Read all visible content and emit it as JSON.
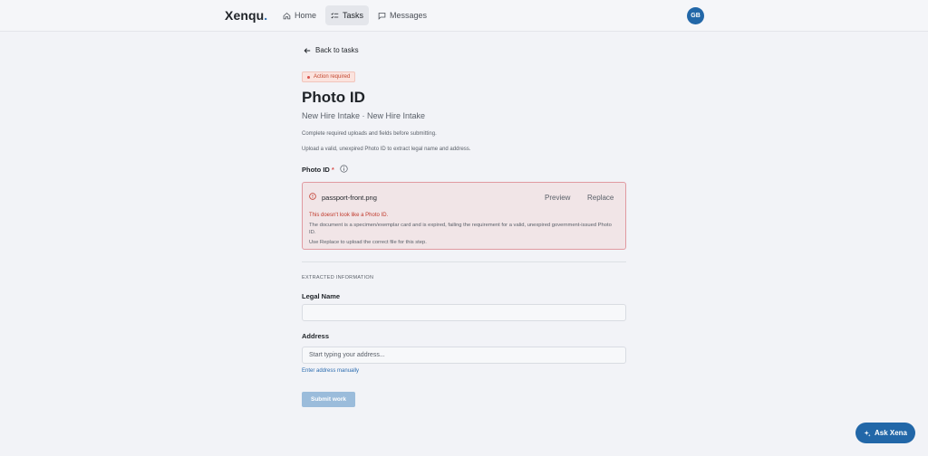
{
  "brand": {
    "name": "Xenqu",
    "suffix": "."
  },
  "nav": {
    "items": [
      {
        "label": "Home",
        "icon": "home-icon"
      },
      {
        "label": "Tasks",
        "icon": "tasks-icon",
        "active": true
      },
      {
        "label": "Messages",
        "icon": "messages-icon"
      }
    ]
  },
  "user": {
    "initials": "GB"
  },
  "back_link": "Back to tasks",
  "status_badge": "Action required",
  "page": {
    "title": "Photo ID",
    "subtitle": "New Hire Intake · New Hire Intake",
    "description_1": "Complete required uploads and fields before submitting.",
    "description_2": "Upload a valid, unexpired Photo ID to extract legal name and address."
  },
  "photo_id_field": {
    "label": "Photo ID",
    "required_mark": "*",
    "file_name": "passport-front.png",
    "preview_label": "Preview",
    "replace_label": "Replace",
    "error_title": "This doesn't look like a Photo ID.",
    "error_body": "The document is a specimen/exemplar card and is expired, failing the requirement for a valid, unexpired government-issued Photo ID.",
    "error_hint": "Use Replace to upload the correct file for this step."
  },
  "extracted": {
    "section_title": "EXTRACTED INFORMATION",
    "legal_name_label": "Legal Name",
    "legal_name_value": "",
    "address_label": "Address",
    "address_placeholder": "Start typing your address...",
    "manual_link": "Enter address manually"
  },
  "submit_label": "Submit work",
  "assistant": {
    "label": "Ask Xena"
  },
  "colors": {
    "accent": "#2267a8",
    "error": "#c0392b",
    "badge_bg": "#fbe3de"
  }
}
